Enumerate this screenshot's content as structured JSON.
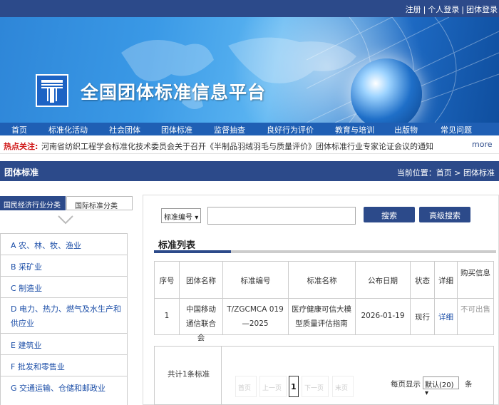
{
  "header": {
    "links": [
      "注册",
      "个人登录",
      "团体登录"
    ],
    "site_title": "全国团体标准信息平台"
  },
  "nav": [
    "首页",
    "标准化活动",
    "社会团体",
    "团体标准",
    "监督抽查",
    "良好行为评价",
    "教育与培训",
    "出版物",
    "常见问题"
  ],
  "hot": {
    "label": "热点关注:",
    "text": "河南省纺织工程学会标准化技术委员会关于召开《半制品羽绒羽毛与质量评价》团体标准行业专家论证会议的通知",
    "more": "more"
  },
  "section": {
    "title": "团体标准",
    "breadcrumb": "当前位置：首页 > 团体标准"
  },
  "left_tabs": [
    "国民经济行业分类",
    "国际标准分类"
  ],
  "categories": [
    "A 农、林、牧、渔业",
    "B 采矿业",
    "C 制造业",
    "D 电力、热力、燃气及水生产和供应业",
    "E 建筑业",
    "F 批发和零售业",
    "G 交通运输、仓储和邮政业"
  ],
  "search": {
    "field_select": "标准编号",
    "query": "",
    "search_button": "搜索",
    "advanced_button": "高级搜索"
  },
  "list": {
    "title": "标准列表",
    "headers": [
      "序号",
      "团体名称",
      "标准编号",
      "标准名称",
      "公布日期",
      "状态",
      "详细",
      "购买信息"
    ],
    "rows": [
      [
        "1",
        "中国移动通信联合会",
        "T/ZGCMCA 019—2025",
        "医疗健康可信大模型质量评估指南",
        "2026-01-19",
        "现行",
        "详细",
        "不可出售"
      ]
    ]
  },
  "pager": {
    "total": "共计1条标准",
    "buttons": [
      "首页",
      "上一页",
      "下一页",
      "末页"
    ],
    "current": "1",
    "per_page_label": "每页显示",
    "per_page_value": "默认(20)",
    "per_page_unit": "条"
  },
  "colors": {
    "primary": "#2c4a8a",
    "nav": "#1f5fb4",
    "hot_label": "#d01818",
    "link": "#1d4fa8"
  }
}
